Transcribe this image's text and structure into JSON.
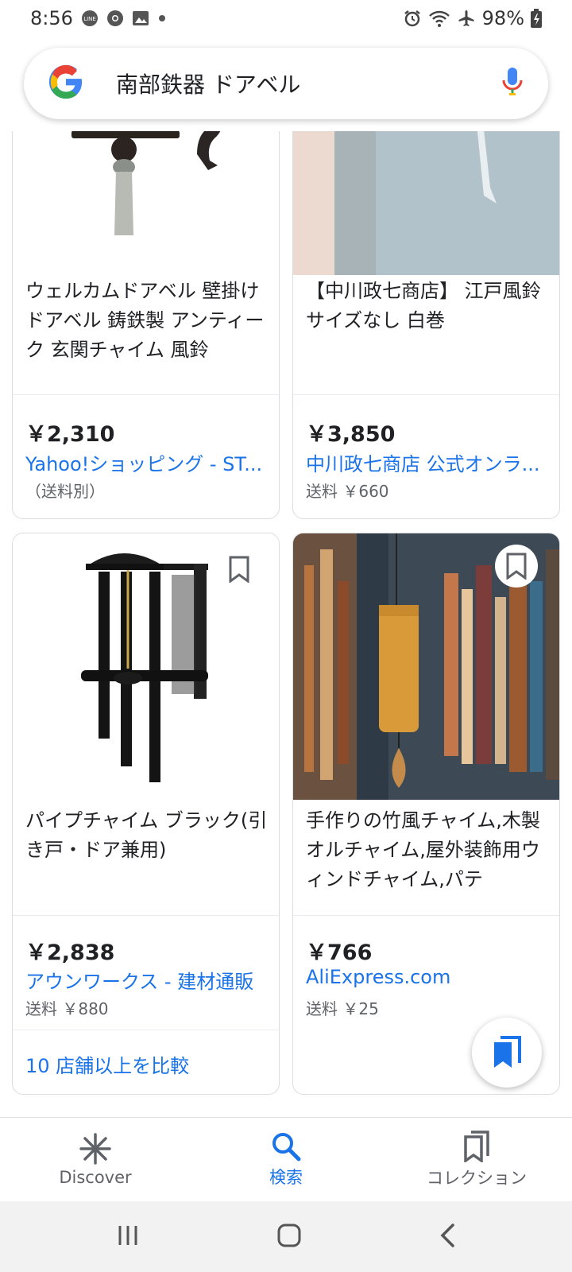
{
  "status_bar": {
    "time": "8:56",
    "battery": "98%",
    "left_icons": [
      "line-icon",
      "chrome-icon",
      "gallery-icon",
      "dot-icon"
    ],
    "right_icons": [
      "alarm-icon",
      "wifi-icon",
      "airplane-icon",
      "battery-icon"
    ]
  },
  "search": {
    "query": "南部鉄器 ドアベル",
    "logo": "google-logo",
    "mic_icon": "mic-icon"
  },
  "products": [
    {
      "title": "ウェルカムドアベル 壁掛け ドアベル 鋳鉄製 アンティーク 玄関チャイム 風鈴",
      "price": "￥2,310",
      "store": "Yahoo!ショッピング - ST...",
      "shipping": "（送料別）"
    },
    {
      "title": "【中川政七商店】 江戸風鈴 サイズなし 白巻",
      "price": "￥3,850",
      "store": "中川政七商店 公式オンラ...",
      "shipping": "送料 ￥660"
    },
    {
      "title": "パイプチャイム ブラック(引き戸・ドア兼用)",
      "price": "￥2,838",
      "store": "アウンワークス - 建材通販",
      "shipping": "送料 ￥880",
      "compare": "10 店舗以上を比較"
    },
    {
      "title": "手作りの竹風チャイム,木製オルチャイム,屋外装飾用ウィンドチャイム,パテ",
      "price": "￥766",
      "store": "AliExpress.com",
      "shipping": "送料 ￥25"
    }
  ],
  "bottom_nav": {
    "discover": "Discover",
    "search": "検索",
    "collections": "コレクション",
    "active": "search"
  },
  "colors": {
    "accent": "#1a73e8",
    "text": "#202124",
    "secondary": "#5f6368"
  }
}
